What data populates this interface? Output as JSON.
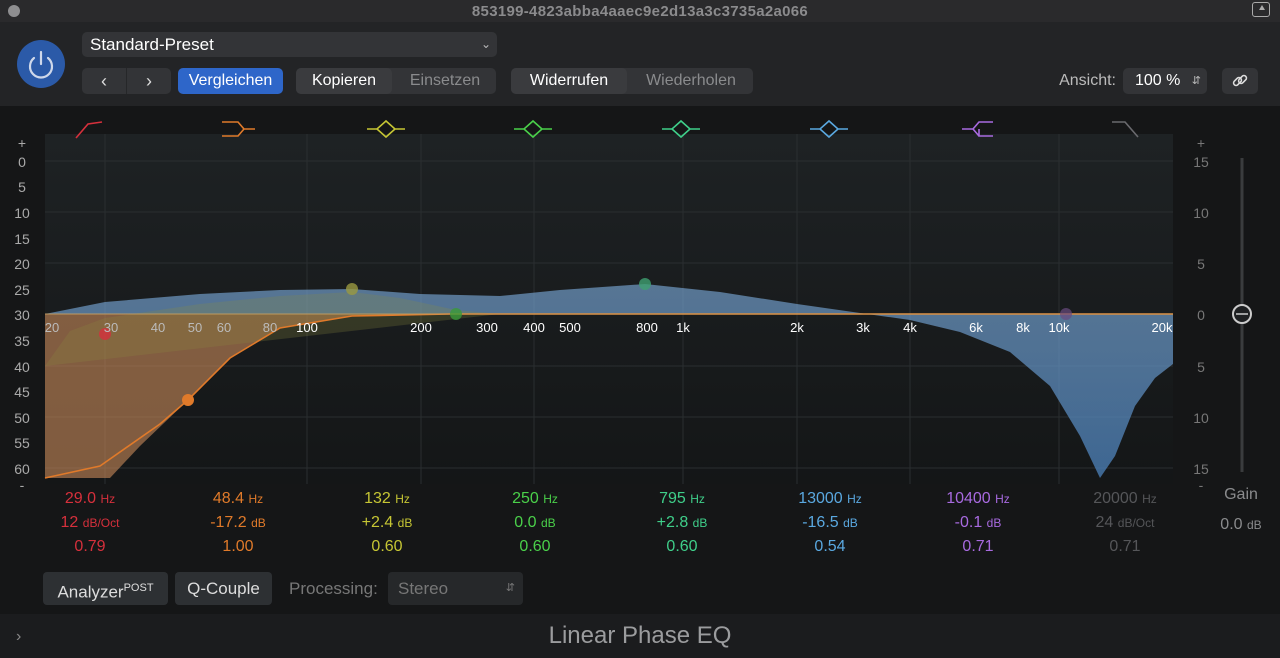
{
  "window": {
    "title": "853199-4823abba4aaec9e2d13a3c3735a2a066"
  },
  "toolbar": {
    "preset": "Standard-Preset",
    "compare": "Vergleichen",
    "copy": "Kopieren",
    "paste": "Einsetzen",
    "undo": "Widerrufen",
    "redo": "Wiederholen",
    "view_label": "Ansicht:",
    "zoom": "100 %"
  },
  "colors": {
    "accent": "#2b5aa8",
    "band1": "#d6303c",
    "band2": "#e07a2a",
    "band3": "#c6c634",
    "band4": "#4ad04a",
    "band5": "#3fcf8a",
    "band6": "#5aa8e0",
    "band7": "#a86ae0",
    "band8": "#6a6a6e"
  },
  "graph": {
    "left_scale": [
      "+",
      "0",
      "5",
      "10",
      "15",
      "20",
      "25",
      "30",
      "35",
      "40",
      "45",
      "50",
      "55",
      "60",
      "-"
    ],
    "right_scale": [
      "+",
      "15",
      "10",
      "5",
      "0",
      "5",
      "10",
      "15",
      "-"
    ],
    "freq_labels": [
      "20",
      "30",
      "40",
      "50",
      "60",
      "80",
      "100",
      "200",
      "300",
      "400",
      "500",
      "800",
      "1k",
      "2k",
      "3k",
      "4k",
      "6k",
      "8k",
      "10k",
      "20k"
    ]
  },
  "bands": [
    {
      "freq": "29.0",
      "unit": "Hz",
      "gain": "12",
      "gain_unit": "dB/Oct",
      "q": "0.79"
    },
    {
      "freq": "48.4",
      "unit": "Hz",
      "gain": "-17.2",
      "gain_unit": "dB",
      "q": "1.00"
    },
    {
      "freq": "132",
      "unit": "Hz",
      "gain": "+2.4",
      "gain_unit": "dB",
      "q": "0.60"
    },
    {
      "freq": "250",
      "unit": "Hz",
      "gain": "0.0",
      "gain_unit": "dB",
      "q": "0.60"
    },
    {
      "freq": "795",
      "unit": "Hz",
      "gain": "+2.8",
      "gain_unit": "dB",
      "q": "0.60"
    },
    {
      "freq": "13000",
      "unit": "Hz",
      "gain": "-16.5",
      "gain_unit": "dB",
      "q": "0.54"
    },
    {
      "freq": "10400",
      "unit": "Hz",
      "gain": "-0.1",
      "gain_unit": "dB",
      "q": "0.71"
    },
    {
      "freq": "20000",
      "unit": "Hz",
      "gain": "24",
      "gain_unit": "dB/Oct",
      "q": "0.71"
    }
  ],
  "gain": {
    "label": "Gain",
    "value": "0.0",
    "unit": "dB"
  },
  "controls": {
    "analyzer": "Analyzer",
    "analyzer_sup": "POST",
    "qcouple": "Q-Couple",
    "processing_label": "Processing:",
    "processing_value": "Stereo"
  },
  "footer": {
    "plugin_name": "Linear Phase EQ"
  }
}
